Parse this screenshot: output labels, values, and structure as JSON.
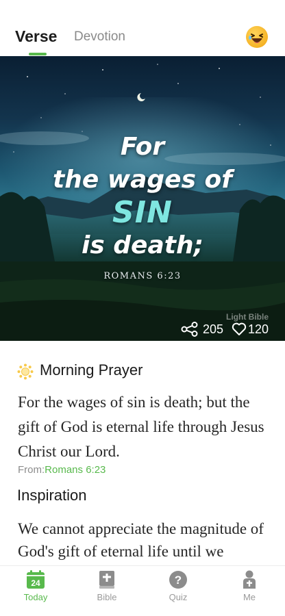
{
  "header": {
    "tabs": [
      {
        "label": "Verse",
        "active": true
      },
      {
        "label": "Devotion",
        "active": false
      }
    ],
    "emoji_icon": "laughing-face-icon"
  },
  "hero": {
    "verse_lines": [
      "For",
      "the wages of",
      "SIN",
      "is death;"
    ],
    "reference": "ROMANS 6:23",
    "watermark": "Light Bible",
    "share_count": "205",
    "like_count": "120"
  },
  "prayer": {
    "title": "Morning Prayer",
    "text": "For the wages of sin is death; but the gift of God is eternal life through Jesus Christ our Lord.",
    "from_label": "From:",
    "from_reference": "Romans 6:23"
  },
  "inspiration": {
    "title": "Inspiration",
    "text": "We cannot appreciate the magnitude of God's gift of eternal life until we"
  },
  "bottom_nav": {
    "today": {
      "label": "Today",
      "date": "24"
    },
    "bible": {
      "label": "Bible"
    },
    "quiz": {
      "label": "Quiz"
    },
    "me": {
      "label": "Me"
    }
  },
  "colors": {
    "accent": "#58b94c",
    "highlight_word": "#7fe6e0"
  }
}
